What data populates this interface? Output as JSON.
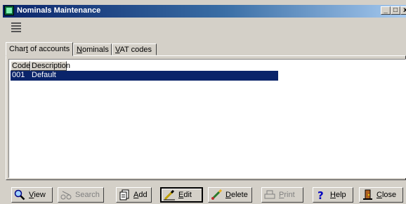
{
  "window": {
    "title": "Nominals Maintenance",
    "controls": {
      "minimize": "_",
      "maximize": "□",
      "close": "x"
    }
  },
  "toolbar": {
    "icon": "list-config-icon"
  },
  "tabs": [
    {
      "pre": "Char",
      "acc": "t",
      "post": " of accounts",
      "active": true
    },
    {
      "pre": "",
      "acc": "N",
      "post": "ominals",
      "active": false
    },
    {
      "pre": "",
      "acc": "V",
      "post": "AT codes",
      "active": false
    }
  ],
  "grid": {
    "columns": [
      "Code",
      "Description"
    ],
    "rows": [
      {
        "code": "001",
        "description": "Default",
        "selected": true
      }
    ]
  },
  "buttons": {
    "view": {
      "acc": "V",
      "rest": "iew",
      "icon": "magnifier-icon",
      "enabled": true
    },
    "search": {
      "acc": "",
      "rest": "Search",
      "icon": "binoculars-icon",
      "enabled": false
    },
    "add": {
      "acc": "A",
      "rest": "dd",
      "icon": "document-add-icon",
      "enabled": true
    },
    "edit": {
      "acc": "E",
      "rest": "dit",
      "icon": "pencil-icon",
      "enabled": true,
      "pressed": true
    },
    "delete": {
      "acc": "D",
      "rest": "elete",
      "icon": "eraser-icon",
      "enabled": true
    },
    "print": {
      "acc": "P",
      "rest": "rint",
      "icon": "printer-icon",
      "enabled": false
    },
    "help": {
      "acc": "H",
      "rest": "elp",
      "icon": "question-icon",
      "enabled": true
    },
    "close": {
      "acc": "C",
      "rest": "lose",
      "icon": "door-exit-icon",
      "enabled": true
    }
  },
  "colors": {
    "selection": "#0a246a",
    "face": "#d4d0c8",
    "titlebar_start": "#0a246a",
    "titlebar_end": "#a6caf0"
  }
}
